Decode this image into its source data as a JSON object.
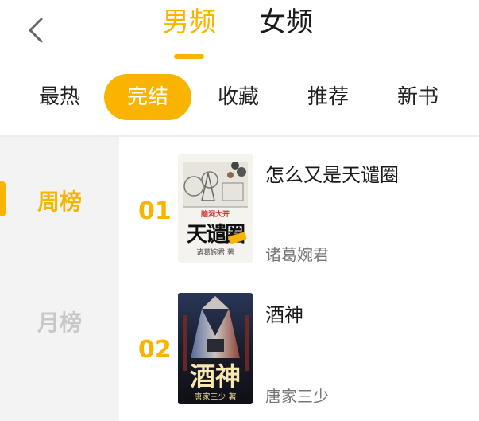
{
  "header": {
    "tabs": [
      {
        "label": "男频"
      },
      {
        "label": "女频"
      }
    ]
  },
  "categories": [
    {
      "label": "最热"
    },
    {
      "label": "完结"
    },
    {
      "label": "收藏"
    },
    {
      "label": "推荐"
    },
    {
      "label": "新书"
    }
  ],
  "ranking_tabs": [
    {
      "label": "周榜"
    },
    {
      "label": "月榜"
    }
  ],
  "books": [
    {
      "rank": "01",
      "title": "怎么又是天谴圈",
      "author": "诸葛婉君",
      "cover": {
        "top_text": "脑洞大开",
        "title_text": "天谴圈",
        "author_text": "诸葛婉君 著"
      }
    },
    {
      "rank": "02",
      "title": "酒神",
      "author": "唐家三少",
      "cover": {
        "title_text": "酒神",
        "author_text": "唐家三少 著"
      }
    }
  ],
  "colors": {
    "accent": "#f8b400",
    "text": "#1a1a1a",
    "muted": "#777777",
    "sidebar_bg": "#f3f3f3"
  },
  "icons": {
    "back": "chevron-left-icon"
  }
}
